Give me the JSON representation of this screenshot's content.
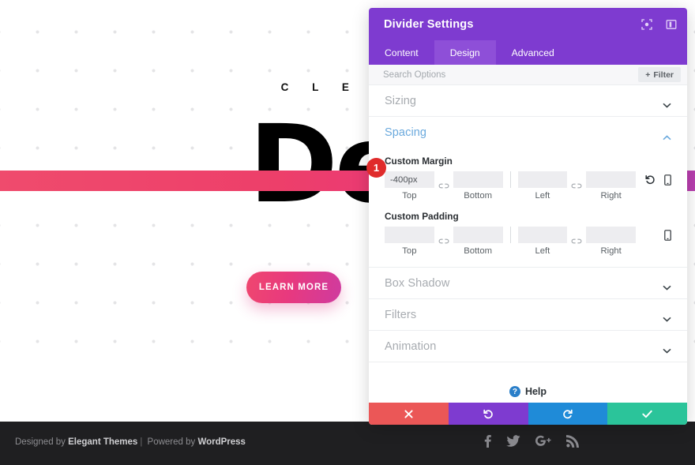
{
  "site": {
    "eyebrow": "C L E A N   &   W H",
    "title": "Desig",
    "cta_label": "LEARN MORE",
    "divider_color_start": "#ef4b6d",
    "divider_color_end": "#b83fb0",
    "footer": {
      "credit_prefix": "Designed by ",
      "credit_brand": "Elegant Themes",
      "credit_separator": "|",
      "credit_middle": " Powered by ",
      "credit_platform": "WordPress",
      "social": [
        {
          "name": "facebook-icon",
          "glyph": "f"
        },
        {
          "name": "twitter-icon",
          "glyph": "t"
        },
        {
          "name": "google-plus-icon",
          "glyph": "G+"
        },
        {
          "name": "rss-icon",
          "glyph": "rss"
        }
      ]
    }
  },
  "panel": {
    "title": "Divider Settings",
    "header_icons": [
      {
        "name": "focus-target-icon"
      },
      {
        "name": "panel-layout-icon"
      }
    ],
    "tabs": [
      {
        "label": "Content",
        "active": false
      },
      {
        "label": "Design",
        "active": true
      },
      {
        "label": "Advanced",
        "active": false
      }
    ],
    "search": {
      "placeholder": "Search Options",
      "value": "",
      "filter_label": "Filter",
      "filter_plus": "+"
    },
    "sections": [
      {
        "label": "Sizing",
        "open": false
      },
      {
        "label": "Spacing",
        "open": true
      },
      {
        "label": "Box Shadow",
        "open": false
      },
      {
        "label": "Filters",
        "open": false
      },
      {
        "label": "Animation",
        "open": false
      }
    ],
    "spacing": {
      "margin": {
        "label": "Custom Margin",
        "fields": [
          {
            "sub": "Top",
            "value": "-400px",
            "placeholder": ""
          },
          {
            "sub": "Bottom",
            "value": "",
            "placeholder": ""
          },
          {
            "sub": "Left",
            "value": "",
            "placeholder": ""
          },
          {
            "sub": "Right",
            "value": "",
            "placeholder": ""
          }
        ],
        "has_reset": true,
        "has_responsive": true
      },
      "padding": {
        "label": "Custom Padding",
        "fields": [
          {
            "sub": "Top",
            "value": "",
            "placeholder": ""
          },
          {
            "sub": "Bottom",
            "value": "",
            "placeholder": ""
          },
          {
            "sub": "Left",
            "value": "",
            "placeholder": ""
          },
          {
            "sub": "Right",
            "value": "",
            "placeholder": ""
          }
        ],
        "has_reset": false,
        "has_responsive": true
      }
    },
    "help_label": "Help",
    "actions": [
      {
        "name": "cancel-button",
        "glyph": "✖",
        "color": "#eb5757"
      },
      {
        "name": "undo-button",
        "glyph": "↺",
        "color": "#7E3BD0"
      },
      {
        "name": "redo-button",
        "glyph": "↻",
        "color": "#1f8bd8"
      },
      {
        "name": "save-button",
        "glyph": "✔",
        "color": "#2bc49a"
      }
    ]
  },
  "annotation": {
    "badge_number": "1",
    "badge_color": "#e02b2b"
  }
}
